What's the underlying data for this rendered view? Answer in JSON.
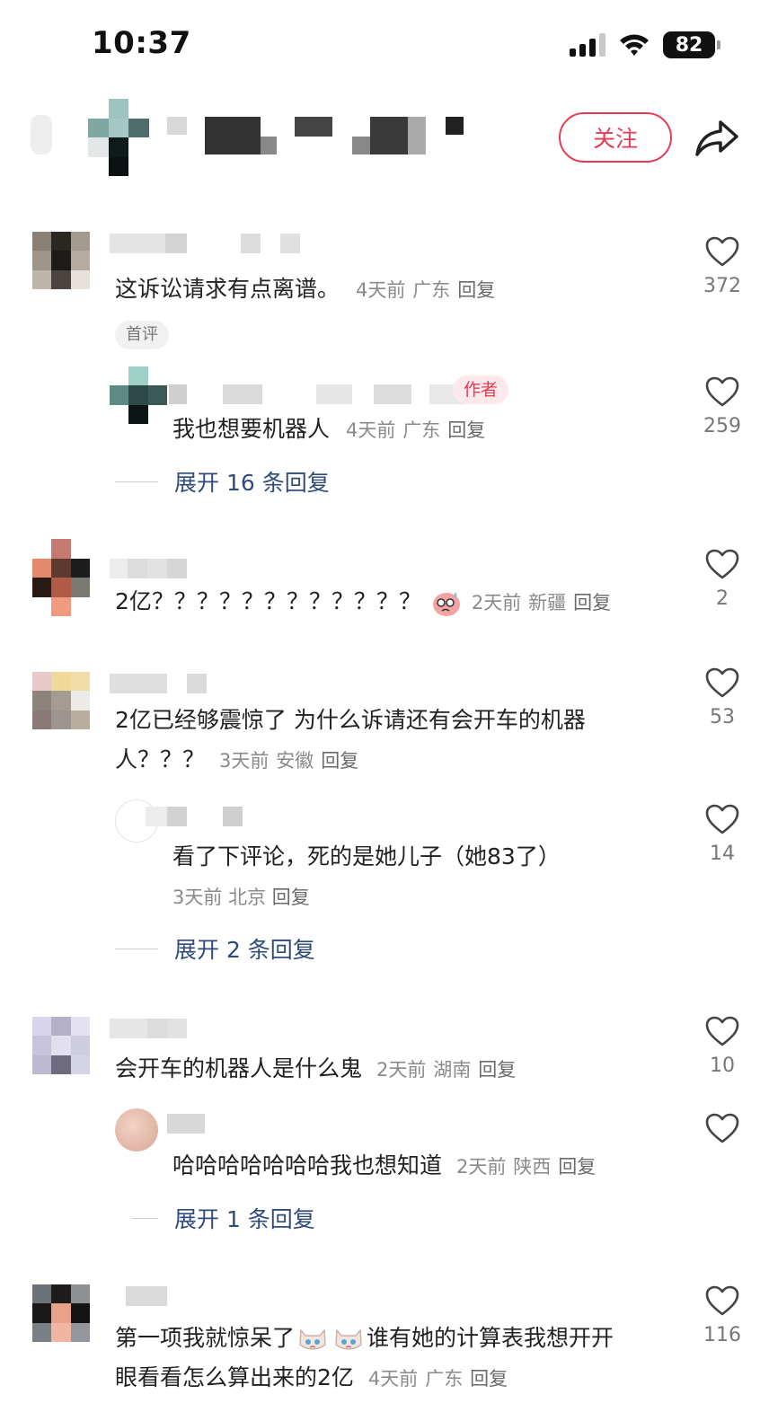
{
  "status_bar": {
    "time": "10:37",
    "battery": "82"
  },
  "header": {
    "follow_label": "关注"
  },
  "comments": [
    {
      "text": "这诉讼请求有点离谱。",
      "time": "4天前",
      "location": "广东",
      "reply": "回复",
      "badge": "首评",
      "likes": "372",
      "replies": [
        {
          "badge": "作者",
          "text": "我也想要机器人",
          "time": "4天前",
          "location": "广东",
          "reply": "回复",
          "likes": "259"
        }
      ],
      "expand": "展开 16 条回复"
    },
    {
      "text": "2亿？？？？？？？？？？？？",
      "time": "2天前",
      "location": "新疆",
      "reply": "回复",
      "likes": "2"
    },
    {
      "text_line1": "2亿已经够震惊了 为什么诉请还有会开车的机器",
      "text_line2": "人？？？",
      "time": "3天前",
      "location": "安徽",
      "reply": "回复",
      "likes": "53",
      "replies": [
        {
          "text": "看了下评论，死的是她儿子（她83了）",
          "time": "3天前",
          "location": "北京",
          "reply": "回复",
          "likes": "14"
        }
      ],
      "expand": "展开 2 条回复"
    },
    {
      "text": "会开车的机器人是什么鬼",
      "time": "2天前",
      "location": "湖南",
      "reply": "回复",
      "likes": "10",
      "replies": [
        {
          "text": "哈哈哈哈哈哈哈我也想知道",
          "time": "2天前",
          "location": "陕西",
          "reply": "回复",
          "likes": ""
        }
      ],
      "expand": "展开 1 条回复"
    },
    {
      "text_line1a": "第一项我就惊呆了",
      "text_line1b": "谁有她的计算表我想开开",
      "text_line2": "眼看看怎么算出来的2亿",
      "time": "4天前",
      "location": "广东",
      "reply": "回复",
      "likes": "116"
    }
  ],
  "colors": {
    "accent": "#e63b54",
    "link": "#2e4b7a",
    "meta": "#8a8a8a"
  }
}
